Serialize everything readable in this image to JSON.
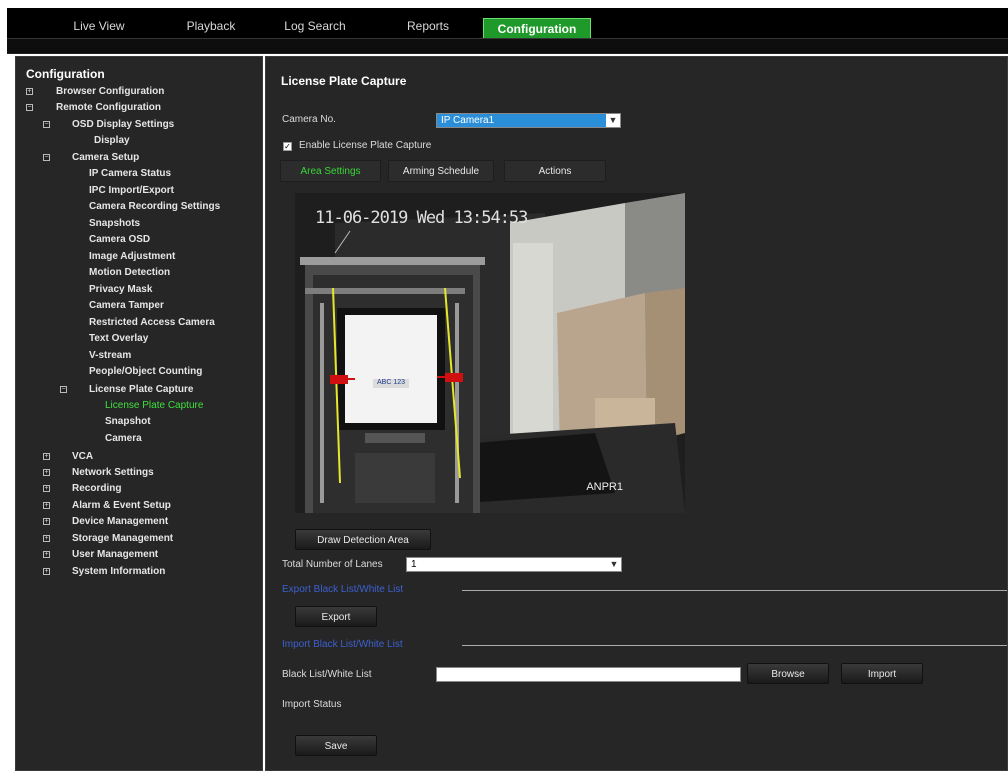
{
  "nav": {
    "tabs": [
      {
        "label": "Live View"
      },
      {
        "label": "Playback"
      },
      {
        "label": "Log Search"
      },
      {
        "label": "Reports"
      },
      {
        "label": "Configuration"
      }
    ]
  },
  "tree": {
    "title": "Configuration",
    "items": [
      {
        "label": "Browser Configuration"
      },
      {
        "label": "Remote Configuration"
      },
      {
        "label": "OSD Display Settings"
      },
      {
        "label": "Display"
      },
      {
        "label": "Camera Setup"
      },
      {
        "label": "IP Camera Status"
      },
      {
        "label": "IPC Import/Export"
      },
      {
        "label": "Camera Recording Settings"
      },
      {
        "label": "Snapshots"
      },
      {
        "label": "Camera OSD"
      },
      {
        "label": "Image Adjustment"
      },
      {
        "label": "Motion Detection"
      },
      {
        "label": "Privacy Mask"
      },
      {
        "label": "Camera Tamper"
      },
      {
        "label": "Restricted Access Camera"
      },
      {
        "label": "Text Overlay"
      },
      {
        "label": "V-stream"
      },
      {
        "label": "People/Object Counting"
      },
      {
        "label": "License Plate Capture"
      },
      {
        "label": "License Plate Capture"
      },
      {
        "label": "Snapshot"
      },
      {
        "label": "Camera"
      },
      {
        "label": "VCA"
      },
      {
        "label": "Network Settings"
      },
      {
        "label": "Recording"
      },
      {
        "label": "Alarm & Event Setup"
      },
      {
        "label": "Device Management"
      },
      {
        "label": "Storage Management"
      },
      {
        "label": "User Management"
      },
      {
        "label": "System Information"
      }
    ]
  },
  "main": {
    "title": "License Plate Capture",
    "camera_no_label": "Camera No.",
    "camera_no_value": "IP Camera1",
    "enable_label": "Enable License Plate Capture",
    "enable_checked": true,
    "tabs": [
      {
        "label": "Area Settings"
      },
      {
        "label": "Arming Schedule"
      },
      {
        "label": "Actions"
      }
    ],
    "camera": {
      "osd_text": "11-06-2019 Wed 13:54:53",
      "name": "ANPR1",
      "plate": "ABC 123"
    },
    "draw_area_button": "Draw Detection Area",
    "lanes_label": "Total Number of Lanes",
    "lanes_value": "1",
    "export_section": "Export Black List/White List",
    "export_button": "Export",
    "import_section": "Import Black List/White List",
    "list_label": "Black List/White List",
    "list_value": "",
    "browse_button": "Browse",
    "import_button": "Import",
    "import_status_label": "Import Status",
    "save_button": "Save"
  },
  "colors": {
    "active_tab": "#1f9a2a",
    "selected_tree_item": "#3fe03f",
    "camera_select": "#2a8fd8",
    "section_link": "#3c60d0"
  }
}
